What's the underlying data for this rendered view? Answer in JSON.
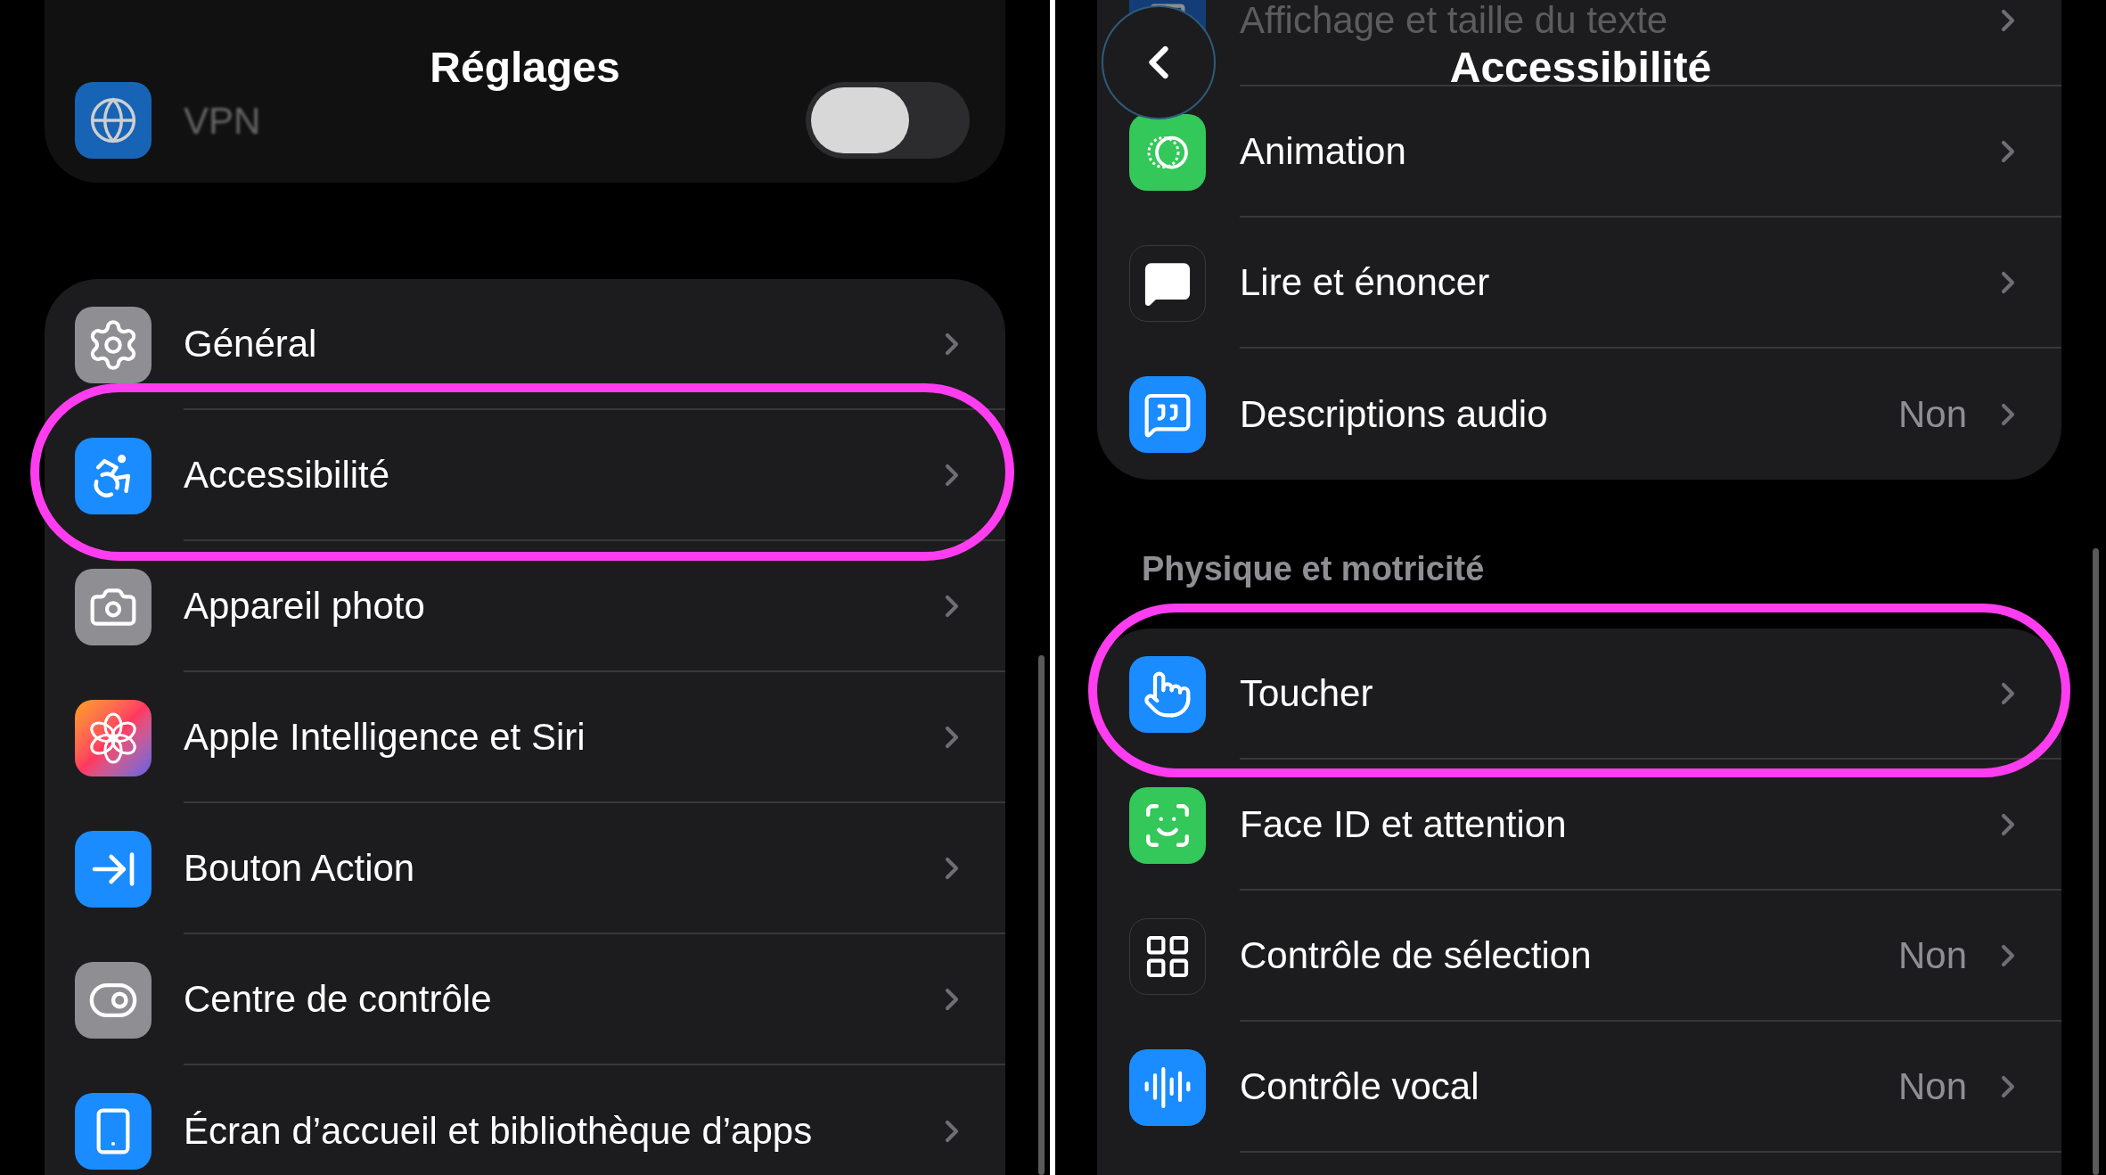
{
  "left": {
    "title": "Réglages",
    "top_items": [
      {
        "label": "VPN",
        "on": false
      }
    ],
    "items": [
      {
        "label": "Général",
        "circled": false
      },
      {
        "label": "Accessibilité",
        "circled": true
      },
      {
        "label": "Appareil photo",
        "circled": false
      },
      {
        "label": "Apple Intelligence et Siri",
        "circled": false
      },
      {
        "label": "Bouton Action",
        "circled": false
      },
      {
        "label": "Centre de contrôle",
        "circled": false
      },
      {
        "label": "Écran d’accueil et bibliothèque d’apps",
        "circled": false
      }
    ]
  },
  "right": {
    "title": "Accessibilité",
    "top_items": [
      {
        "label": "Affichage et taille du texte",
        "circled": false
      },
      {
        "label": "Animation",
        "circled": false
      },
      {
        "label": "Lire et énoncer",
        "circled": false
      },
      {
        "label": "Descriptions audio",
        "value": "Non",
        "circled": false
      }
    ],
    "section": {
      "header": "Physique et motricité",
      "items": [
        {
          "label": "Toucher",
          "circled": true
        },
        {
          "label": "Face ID et attention",
          "circled": false
        },
        {
          "label": "Contrôle de sélection",
          "value": "Non",
          "circled": false
        },
        {
          "label": "Contrôle vocal",
          "value": "Non",
          "circled": false
        }
      ]
    }
  }
}
